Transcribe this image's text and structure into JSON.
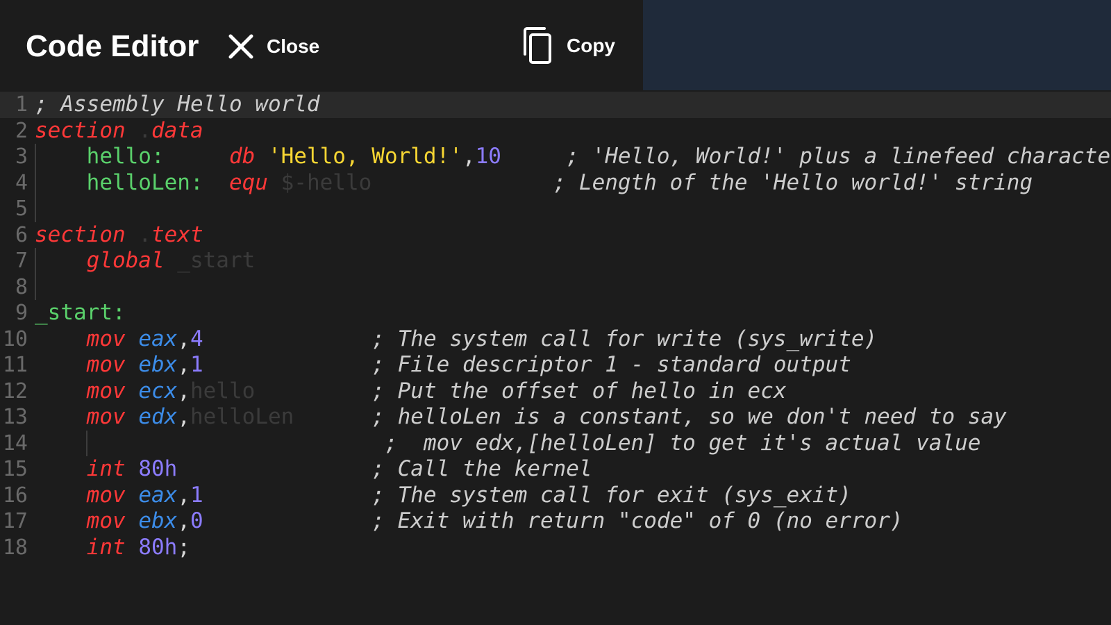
{
  "header": {
    "title": "Code Editor",
    "close_label": "Close",
    "copy_label": "Copy"
  },
  "icons": {
    "close": "close-icon",
    "copy": "copy-icon"
  },
  "colors": {
    "keyword": "#ff3838",
    "register": "#3c8ce8",
    "label": "#5ad16b",
    "string": "#f7d633",
    "number": "#8c7cff",
    "comment": "#cdcdcd",
    "side_panel": "#1f2a3a"
  },
  "editor": {
    "lines": [
      {
        "n": "1",
        "active": true,
        "guides": 0,
        "tokens": [
          {
            "t": "; Assembly Hello world",
            "c": "comment"
          }
        ]
      },
      {
        "n": "2",
        "guides": 0,
        "tokens": [
          {
            "t": "section",
            "c": "kw-red"
          },
          {
            "t": " .",
            "c": "dim"
          },
          {
            "t": "data",
            "c": "kw-red"
          }
        ]
      },
      {
        "n": "3",
        "guides": 1,
        "tokens": [
          {
            "t": "    ",
            "c": "plain"
          },
          {
            "t": "hello:",
            "c": "label-green"
          },
          {
            "t": "     ",
            "c": "plain"
          },
          {
            "t": "db",
            "c": "kw-red"
          },
          {
            "t": " ",
            "c": "plain"
          },
          {
            "t": "'Hello, World!'",
            "c": "str-yellow"
          },
          {
            "t": ",",
            "c": "plain"
          },
          {
            "t": "10",
            "c": "num-purple"
          },
          {
            "t": "     ",
            "c": "plain"
          },
          {
            "t": "; 'Hello, World!' plus a linefeed characte",
            "c": "comment"
          }
        ]
      },
      {
        "n": "4",
        "guides": 1,
        "tokens": [
          {
            "t": "    ",
            "c": "plain"
          },
          {
            "t": "helloLen:",
            "c": "label-green"
          },
          {
            "t": "  ",
            "c": "plain"
          },
          {
            "t": "equ",
            "c": "kw-red"
          },
          {
            "t": " $-hello",
            "c": "dim"
          },
          {
            "t": "              ",
            "c": "plain"
          },
          {
            "t": "; Length of the 'Hello world!' string",
            "c": "comment"
          }
        ]
      },
      {
        "n": "5",
        "guides": 1,
        "tokens": []
      },
      {
        "n": "6",
        "guides": 0,
        "tokens": [
          {
            "t": "section",
            "c": "kw-red"
          },
          {
            "t": " .",
            "c": "dim"
          },
          {
            "t": "text",
            "c": "kw-red"
          }
        ]
      },
      {
        "n": "7",
        "guides": 1,
        "tokens": [
          {
            "t": "    ",
            "c": "plain"
          },
          {
            "t": "global",
            "c": "kw-red"
          },
          {
            "t": " _start",
            "c": "dim"
          }
        ]
      },
      {
        "n": "8",
        "guides": 1,
        "tokens": []
      },
      {
        "n": "9",
        "guides": 0,
        "tokens": [
          {
            "t": "_start:",
            "c": "label-green"
          }
        ]
      },
      {
        "n": "10",
        "guides": 0,
        "tokens": [
          {
            "t": "    ",
            "c": "plain"
          },
          {
            "t": "mov",
            "c": "kw-red"
          },
          {
            "t": " ",
            "c": "plain"
          },
          {
            "t": "eax",
            "c": "kw-blue"
          },
          {
            "t": ",",
            "c": "plain"
          },
          {
            "t": "4",
            "c": "num-purple"
          },
          {
            "t": "             ",
            "c": "plain"
          },
          {
            "t": "; The system call for write (sys_write)",
            "c": "comment"
          }
        ]
      },
      {
        "n": "11",
        "guides": 0,
        "tokens": [
          {
            "t": "    ",
            "c": "plain"
          },
          {
            "t": "mov",
            "c": "kw-red"
          },
          {
            "t": " ",
            "c": "plain"
          },
          {
            "t": "ebx",
            "c": "kw-blue"
          },
          {
            "t": ",",
            "c": "plain"
          },
          {
            "t": "1",
            "c": "num-purple"
          },
          {
            "t": "             ",
            "c": "plain"
          },
          {
            "t": "; File descriptor 1 - standard output",
            "c": "comment"
          }
        ]
      },
      {
        "n": "12",
        "guides": 0,
        "tokens": [
          {
            "t": "    ",
            "c": "plain"
          },
          {
            "t": "mov",
            "c": "kw-red"
          },
          {
            "t": " ",
            "c": "plain"
          },
          {
            "t": "ecx",
            "c": "kw-blue"
          },
          {
            "t": ",",
            "c": "plain"
          },
          {
            "t": "hello",
            "c": "dim"
          },
          {
            "t": "         ",
            "c": "plain"
          },
          {
            "t": "; Put the offset of hello in ecx",
            "c": "comment"
          }
        ]
      },
      {
        "n": "13",
        "guides": 0,
        "tokens": [
          {
            "t": "    ",
            "c": "plain"
          },
          {
            "t": "mov",
            "c": "kw-red"
          },
          {
            "t": " ",
            "c": "plain"
          },
          {
            "t": "edx",
            "c": "kw-blue"
          },
          {
            "t": ",",
            "c": "plain"
          },
          {
            "t": "helloLen",
            "c": "dim"
          },
          {
            "t": "      ",
            "c": "plain"
          },
          {
            "t": "; helloLen is a constant, so we don't need to say",
            "c": "comment"
          }
        ]
      },
      {
        "n": "14",
        "guides": 2,
        "tokens": [
          {
            "t": "                           ",
            "c": "plain"
          },
          {
            "t": ";  mov edx,[helloLen] to get it's actual value",
            "c": "comment"
          }
        ]
      },
      {
        "n": "15",
        "guides": 0,
        "tokens": [
          {
            "t": "    ",
            "c": "plain"
          },
          {
            "t": "int",
            "c": "kw-red"
          },
          {
            "t": " ",
            "c": "plain"
          },
          {
            "t": "80h",
            "c": "num-purple"
          },
          {
            "t": "               ",
            "c": "plain"
          },
          {
            "t": "; Call the kernel",
            "c": "comment"
          }
        ]
      },
      {
        "n": "16",
        "guides": 0,
        "tokens": [
          {
            "t": "    ",
            "c": "plain"
          },
          {
            "t": "mov",
            "c": "kw-red"
          },
          {
            "t": " ",
            "c": "plain"
          },
          {
            "t": "eax",
            "c": "kw-blue"
          },
          {
            "t": ",",
            "c": "plain"
          },
          {
            "t": "1",
            "c": "num-purple"
          },
          {
            "t": "             ",
            "c": "plain"
          },
          {
            "t": "; The system call for exit (sys_exit)",
            "c": "comment"
          }
        ]
      },
      {
        "n": "17",
        "guides": 0,
        "tokens": [
          {
            "t": "    ",
            "c": "plain"
          },
          {
            "t": "mov",
            "c": "kw-red"
          },
          {
            "t": " ",
            "c": "plain"
          },
          {
            "t": "ebx",
            "c": "kw-blue"
          },
          {
            "t": ",",
            "c": "plain"
          },
          {
            "t": "0",
            "c": "num-purple"
          },
          {
            "t": "             ",
            "c": "plain"
          },
          {
            "t": "; Exit with return \"code\" of 0 (no error)",
            "c": "comment"
          }
        ]
      },
      {
        "n": "18",
        "guides": 0,
        "tokens": [
          {
            "t": "    ",
            "c": "plain"
          },
          {
            "t": "int",
            "c": "kw-red"
          },
          {
            "t": " ",
            "c": "plain"
          },
          {
            "t": "80h",
            "c": "num-purple"
          },
          {
            "t": ";",
            "c": "plain"
          }
        ]
      }
    ]
  }
}
